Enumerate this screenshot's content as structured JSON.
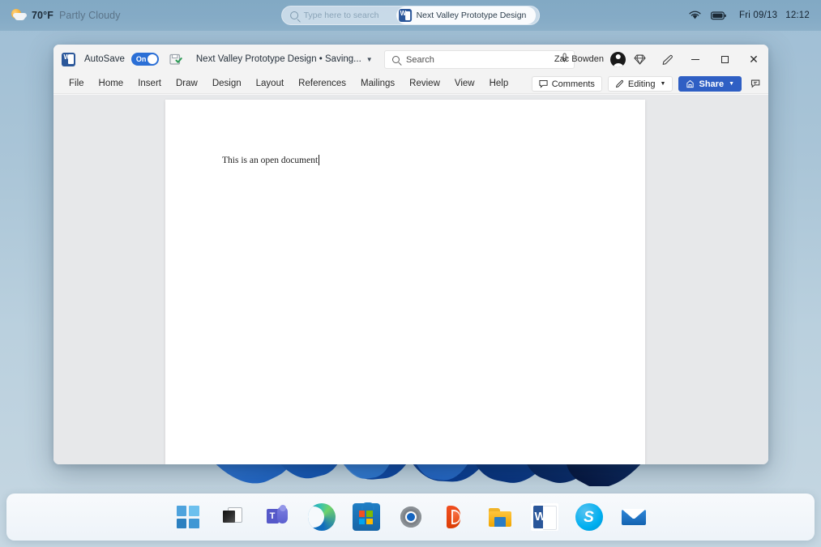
{
  "topbar": {
    "weather": {
      "icon": "partly-cloudy-icon",
      "temperature": "70°F",
      "condition": "Partly Cloudy"
    },
    "search": {
      "icon": "search-icon",
      "placeholder": "Type here to search"
    },
    "suggestion_chip": {
      "icon": "word-icon",
      "label": "Next Valley Prototype Design"
    },
    "tray": {
      "wifi_icon": "wifi-icon",
      "battery_icon": "battery-icon",
      "date": "Fri 09/13",
      "time": "12:12"
    }
  },
  "word": {
    "titlebar": {
      "app_icon": "word-icon",
      "autosave_label": "AutoSave",
      "autosave_state": "On",
      "save_icon": "save-icon",
      "document_title": "Next Valley Prototype Design • Saving...",
      "title_chevron": "chevron-down-icon",
      "search_placeholder": "Search",
      "search_icon": "search-icon",
      "mic_icon": "microphone-icon",
      "user_name": "Zac Bowden",
      "avatar": "user-avatar",
      "premium_icon": "diamond-icon",
      "copilot_icon": "pen-icon",
      "minimize_icon": "minimize-icon",
      "maximize_icon": "maximize-icon",
      "close_icon": "close-icon"
    },
    "ribbon": {
      "tabs": [
        {
          "label": "File"
        },
        {
          "label": "Home"
        },
        {
          "label": "Insert"
        },
        {
          "label": "Draw"
        },
        {
          "label": "Design"
        },
        {
          "label": "Layout"
        },
        {
          "label": "References"
        },
        {
          "label": "Mailings"
        },
        {
          "label": "Review"
        },
        {
          "label": "View"
        },
        {
          "label": "Help"
        }
      ],
      "comments_label": "Comments",
      "comments_icon": "comment-icon",
      "editing_label": "Editing",
      "editing_icon": "pencil-icon",
      "editing_chevron": "chevron-down-icon",
      "share_label": "Share",
      "share_icon": "share-icon",
      "share_chevron": "chevron-down-icon",
      "ribbon_display_icon": "ribbon-display-options-icon"
    },
    "document": {
      "body_text": "This is an open document"
    },
    "colors": {
      "accent": "#2f5fc4",
      "word_blue": "#2b579a",
      "toggle_on": "#2b6fd6"
    }
  },
  "taskbar": {
    "items": [
      {
        "name": "start",
        "label": "Start"
      },
      {
        "name": "task-view",
        "label": "Task View"
      },
      {
        "name": "teams",
        "label": "Microsoft Teams"
      },
      {
        "name": "edge",
        "label": "Microsoft Edge"
      },
      {
        "name": "store",
        "label": "Microsoft Store"
      },
      {
        "name": "settings",
        "label": "Settings"
      },
      {
        "name": "office",
        "label": "Office"
      },
      {
        "name": "file-explorer",
        "label": "File Explorer"
      },
      {
        "name": "word",
        "label": "Microsoft Word"
      },
      {
        "name": "skype",
        "label": "Skype"
      },
      {
        "name": "mail",
        "label": "Mail"
      }
    ],
    "skype_glyph": "S"
  },
  "desktop": {
    "wallpaper": "windows-11-bloom"
  }
}
